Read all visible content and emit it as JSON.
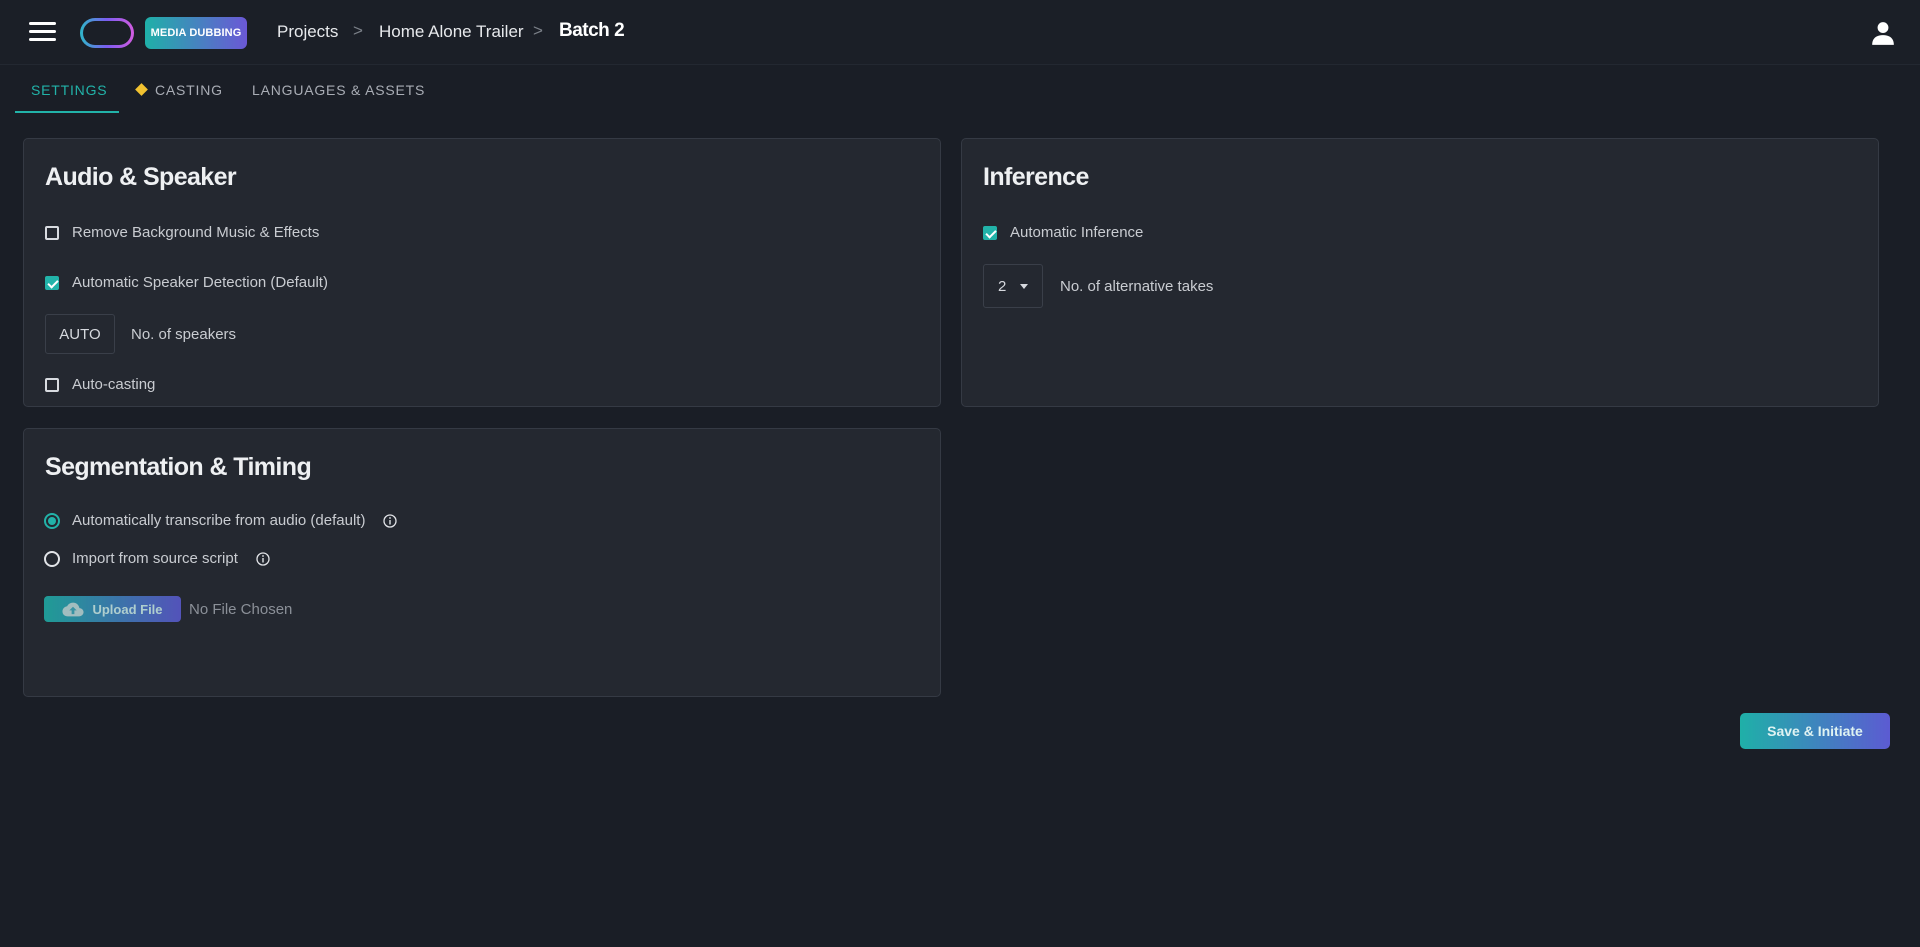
{
  "header": {
    "brand_badge": "MEDIA DUBBING",
    "breadcrumbs": [
      "Projects",
      "Home Alone Trailer"
    ],
    "current": "Batch 2",
    "separator": ">"
  },
  "tabs": [
    {
      "label": "SETTINGS",
      "active": true
    },
    {
      "label": "CASTING",
      "active": false,
      "marker": "diamond"
    },
    {
      "label": "LANGUAGES & ASSETS",
      "active": false
    }
  ],
  "audio_speaker": {
    "title": "Audio & Speaker",
    "remove_bg": {
      "label": "Remove Background Music & Effects",
      "checked": false
    },
    "speaker_detection": {
      "label": "Automatic Speaker Detection (Default)",
      "checked": true
    },
    "speakers": {
      "value": "AUTO",
      "label": "No. of speakers"
    },
    "auto_casting": {
      "label": "Auto-casting",
      "checked": false
    }
  },
  "inference": {
    "title": "Inference",
    "automatic": {
      "label": "Automatic Inference",
      "checked": true
    },
    "takes": {
      "value": "2",
      "label": "No. of alternative takes"
    }
  },
  "segmentation": {
    "title": "Segmentation & Timing",
    "option_auto": {
      "label": "Automatically transcribe from audio (default)",
      "selected": true
    },
    "option_import": {
      "label": "Import from source script",
      "selected": false
    },
    "upload_label": "Upload File",
    "file_status": "No File Chosen"
  },
  "actions": {
    "save_label": "Save & Initiate"
  },
  "colors": {
    "accent": "#22b3a9",
    "background": "#1a1e26",
    "card": "#242830"
  },
  "icons": [
    "menu-icon",
    "user-icon",
    "info-icon",
    "cloud-upload-icon",
    "caret-down-icon"
  ]
}
